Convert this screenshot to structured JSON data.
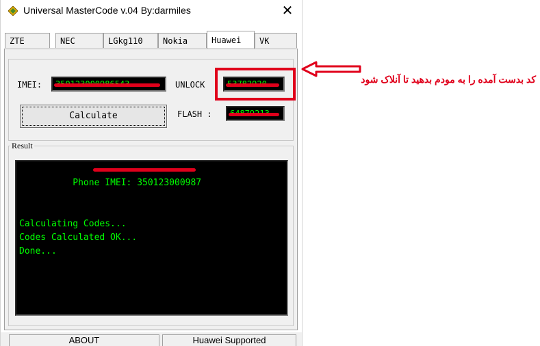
{
  "window": {
    "title": "Universal MasterCode v.04 By:darmiles",
    "close_label": "✕"
  },
  "tabs": [
    {
      "label": "ZTE"
    },
    {
      "label": "NEC"
    },
    {
      "label": "LGkg110"
    },
    {
      "label": "Nokia"
    },
    {
      "label": "Huawei"
    },
    {
      "label": "VK"
    }
  ],
  "active_tab": "Huawei",
  "fields": {
    "imei_label": "IMEI:",
    "imei_value": "350123000986543",
    "unlock_label": "UNLOCK",
    "unlock_value": "53782920",
    "flash_label": "FLASH :",
    "flash_value": "64879213"
  },
  "calculate_label": "Calculate",
  "result": {
    "legend": "Result",
    "lines": [
      "Phone IMEI: 350123000987",
      "Calculating Codes...",
      "Codes Calculated OK...",
      "Done..."
    ]
  },
  "status": {
    "left": "ABOUT",
    "right": "Huawei Supported"
  },
  "annotation": {
    "text": "کد بدست آمده را به مودم بدهید تا آنلاک شود"
  },
  "colors": {
    "console_text": "#00ff00",
    "annotation_red": "#e0001b"
  }
}
